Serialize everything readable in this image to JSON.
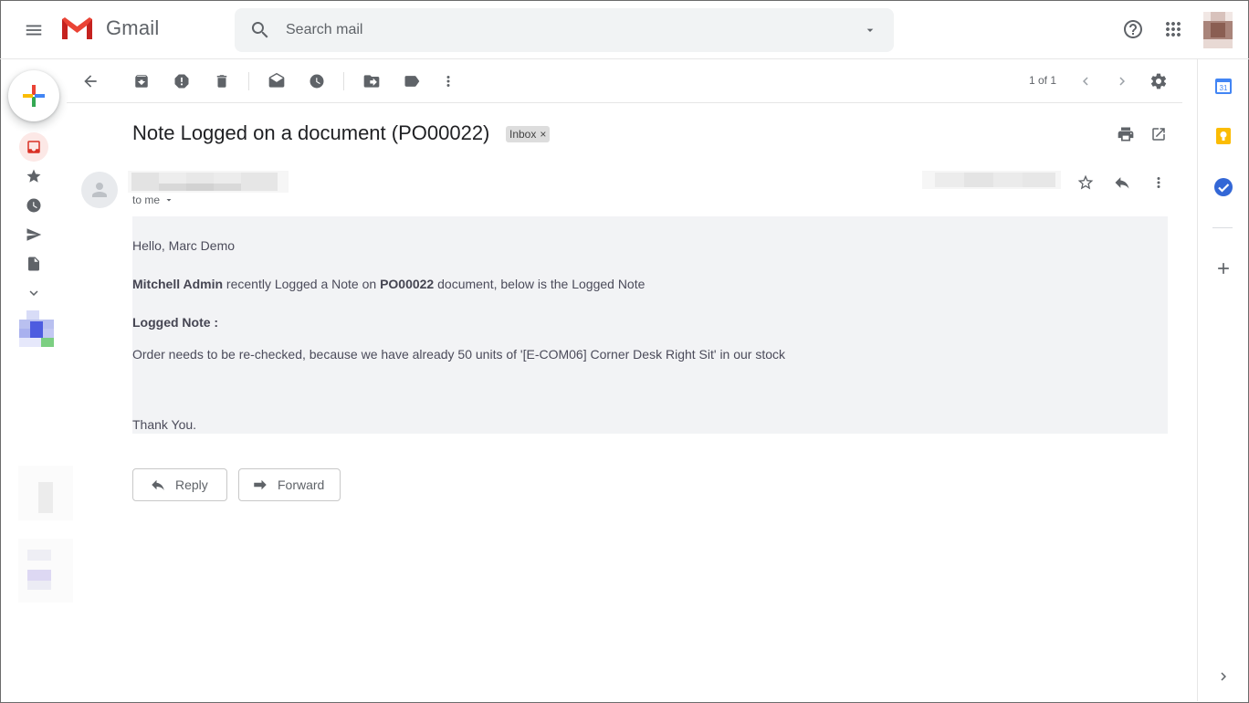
{
  "app": {
    "name": "Gmail"
  },
  "search": {
    "placeholder": "Search mail"
  },
  "toolbar": {
    "pager_text": "1 of 1"
  },
  "message": {
    "subject": "Note Logged on a document (PO00022)",
    "label": "Inbox",
    "label_remove": "×",
    "recipient_text": "to me",
    "greeting": "Hello, Marc Demo",
    "author_name": "Mitchell Admin",
    "middle_text": " recently Logged a Note on ",
    "document_ref": "PO00022",
    "end_text": " document, below is the Logged Note",
    "note_heading": "Logged Note :",
    "note_body": "Order needs to be re-checked, because we have already 50 units of '[E-COM06] Corner Desk Right Sit' in our stock",
    "closing": "Thank You."
  },
  "actions": {
    "reply_label": "Reply",
    "forward_label": "Forward"
  },
  "side_panel": {
    "calendar_day": "31"
  },
  "colors": {
    "brand_red": "#ea4335",
    "brand_blue": "#4285f4",
    "brand_yellow": "#fbbc04",
    "brand_green": "#34a853",
    "body_background": "#f2f3f5"
  },
  "icons": [
    "menu-icon",
    "gmail-logo-icon",
    "search-icon",
    "search-options-icon",
    "help-icon",
    "apps-icon",
    "compose-icon",
    "inbox-icon",
    "star-icon",
    "clock-icon",
    "send-icon",
    "draft-icon",
    "chevron-down-icon",
    "back-icon",
    "archive-icon",
    "report-spam-icon",
    "delete-icon",
    "mark-unread-icon",
    "snooze-icon",
    "move-to-icon",
    "label-icon",
    "more-icon",
    "prev-icon",
    "next-icon",
    "settings-icon",
    "print-icon",
    "open-new-window-icon",
    "person-icon",
    "reply-icon",
    "forward-icon",
    "calendar-icon",
    "keep-icon",
    "tasks-icon",
    "add-icon",
    "expand-panel-icon"
  ]
}
